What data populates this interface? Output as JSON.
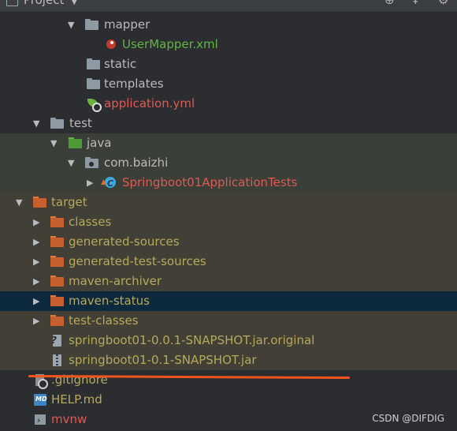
{
  "header": {
    "title": "Project"
  },
  "tree": [
    {
      "label": "mapper",
      "kind": "folder-gray",
      "arrow": "down"
    },
    {
      "label": "UserMapper.xml",
      "kind": "mybatis"
    },
    {
      "label": "static",
      "kind": "folder-gray"
    },
    {
      "label": "templates",
      "kind": "folder-gray"
    },
    {
      "label": "application.yml",
      "kind": "spring-yml"
    },
    {
      "label": "test",
      "kind": "folder-gray",
      "arrow": "down"
    },
    {
      "label": "java",
      "kind": "folder-green",
      "arrow": "down"
    },
    {
      "label": "com.baizhi",
      "kind": "package",
      "arrow": "down"
    },
    {
      "label": "Springboot01ApplicationTests",
      "kind": "junit-class",
      "arrow": "right"
    },
    {
      "label": "target",
      "kind": "folder-orange",
      "arrow": "down"
    },
    {
      "label": "classes",
      "kind": "folder-orange",
      "arrow": "right"
    },
    {
      "label": "generated-sources",
      "kind": "folder-orange",
      "arrow": "right"
    },
    {
      "label": "generated-test-sources",
      "kind": "folder-orange",
      "arrow": "right"
    },
    {
      "label": "maven-archiver",
      "kind": "folder-orange",
      "arrow": "right"
    },
    {
      "label": "maven-status",
      "kind": "folder-orange",
      "arrow": "right",
      "selected": true
    },
    {
      "label": "test-classes",
      "kind": "folder-orange",
      "arrow": "right"
    },
    {
      "label": "springboot01-0.0.1-SNAPSHOT.jar.original",
      "kind": "unknown-file"
    },
    {
      "label": "springboot01-0.1-SNAPSHOT.jar",
      "kind": "jar-file"
    },
    {
      "label": ".gitignore",
      "kind": "gitignore-file"
    },
    {
      "label": "HELP.md",
      "kind": "markdown-file"
    },
    {
      "label": "mvnw",
      "kind": "shell-file"
    }
  ],
  "watermark": "CSDN @DIFDIG",
  "colors": {
    "background": "#2b2d30",
    "test_highlight": "#3a3f38",
    "excluded_highlight": "#423f36",
    "selection": "#0d293e",
    "annotation_stroke": "#f05520"
  }
}
